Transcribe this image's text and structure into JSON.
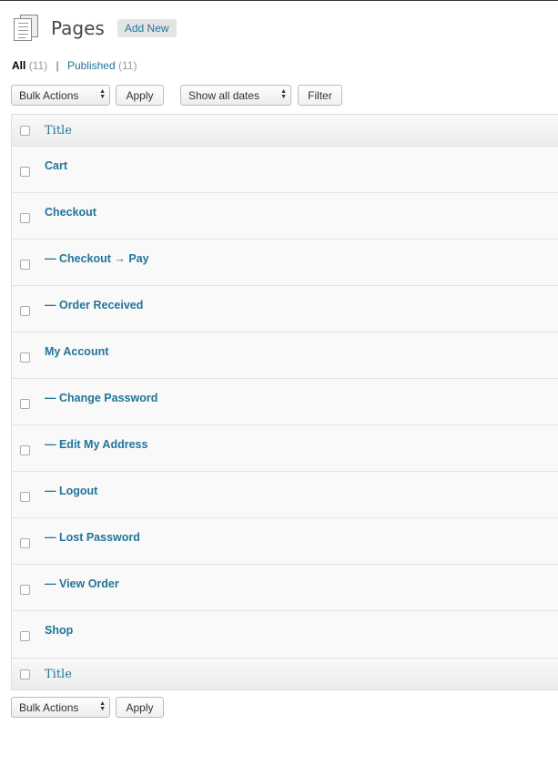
{
  "header": {
    "title": "Pages",
    "add_new_label": "Add New",
    "icon": "pages-icon"
  },
  "views": {
    "all_label": "All",
    "all_count": "(11)",
    "separator": "|",
    "published_label": "Published",
    "published_count": "(11)"
  },
  "top_nav": {
    "bulk_actions": "Bulk Actions",
    "apply": "Apply",
    "dates": "Show all dates",
    "filter": "Filter"
  },
  "table": {
    "column_title": "Title",
    "rows": [
      "Cart",
      "Checkout",
      "— Checkout → Pay",
      "— Order Received",
      "My Account",
      "— Change Password",
      "— Edit My Address",
      "— Logout",
      "— Lost Password",
      "— View Order",
      "Shop"
    ]
  },
  "bottom_nav": {
    "bulk_actions": "Bulk Actions",
    "apply": "Apply"
  }
}
